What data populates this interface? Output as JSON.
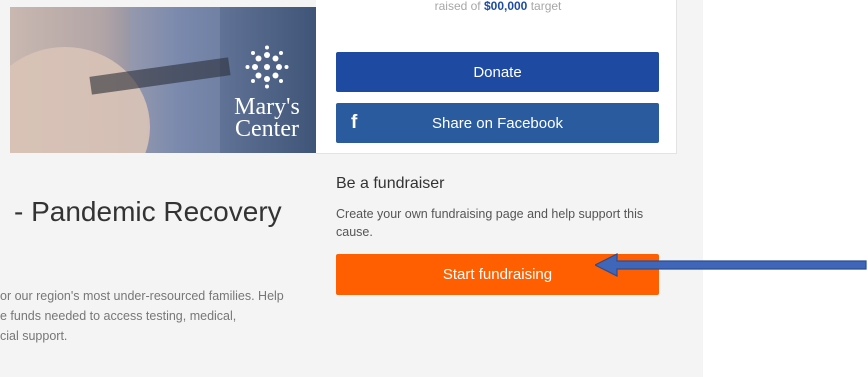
{
  "donation": {
    "target_prefix": "raised of ",
    "target_amount": "$00,000",
    "target_suffix": " target",
    "donate_label": "Donate",
    "share_label": "Share on Facebook",
    "share_icon": "facebook-icon"
  },
  "hero": {
    "logo_line1": "Mary's",
    "logo_line2": "Center"
  },
  "fundraiser": {
    "heading": "Be a fundraiser",
    "description": "Create your own fundraising page and help support this cause.",
    "start_label": "Start fundraising"
  },
  "campaign": {
    "title": "- Pandemic Recovery",
    "desc_lines": [
      "or our region's most under-resourced families. Help",
      "e funds needed to access testing, medical,",
      "cial support."
    ]
  },
  "colors": {
    "donate": "#1e4aa1",
    "share": "#2a5b9e",
    "start": "#ff5f00",
    "arrow": "#3f66b8"
  }
}
